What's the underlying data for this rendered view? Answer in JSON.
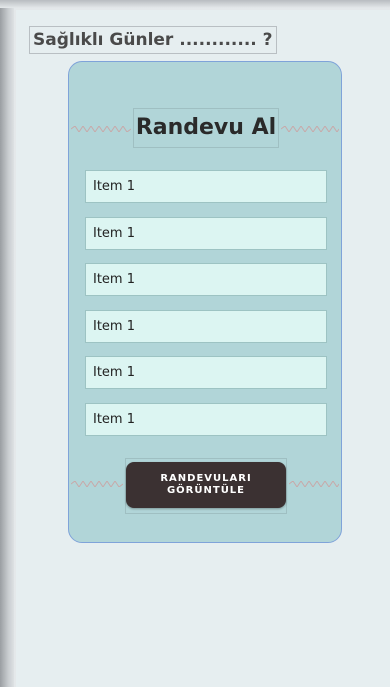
{
  "app": {
    "title": "Sağlıklı Günler ............ ?"
  },
  "card": {
    "heading": "Randevu Al",
    "items": [
      {
        "label": "Item 1"
      },
      {
        "label": "Item 1"
      },
      {
        "label": "Item 1"
      },
      {
        "label": "Item 1"
      },
      {
        "label": "Item 1"
      },
      {
        "label": "Item 1"
      }
    ],
    "button_label": "RANDEVULARI\nGÖRÜNTÜLE"
  },
  "colors": {
    "background": "#e6eef0",
    "card": "#b1d5d8",
    "item": "#dcf5f2",
    "button": "#3b3132",
    "selection_border": "#7fa3d9"
  }
}
